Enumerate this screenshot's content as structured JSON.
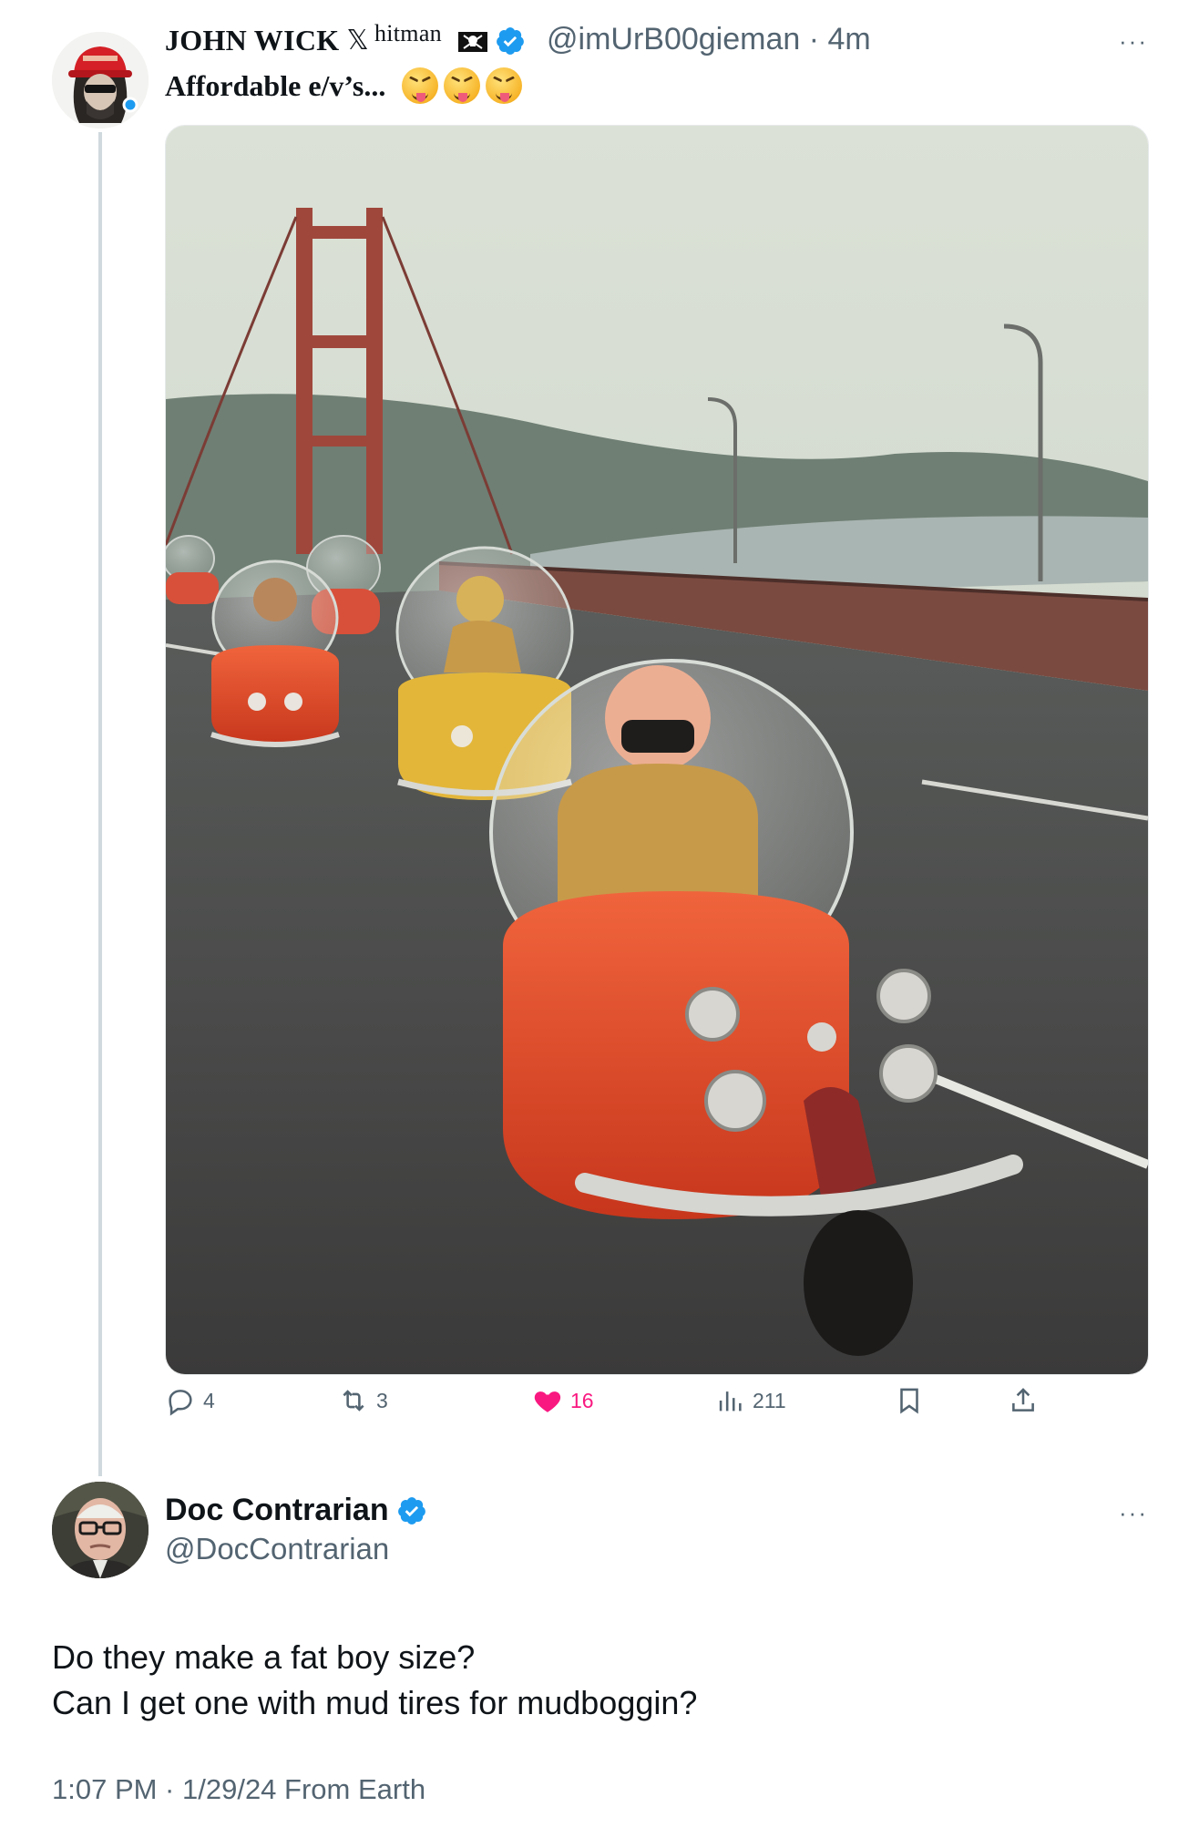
{
  "colors": {
    "verified": "#1d9bf0",
    "like": "#f91880",
    "secondary_text": "#536471",
    "primary_text": "#0f1419"
  },
  "tweet": {
    "author": {
      "display_name": "JOHN WICK",
      "x_glyph": "𝕏",
      "name_suffix": "hitman",
      "flag_icon": "pirate-flag-icon",
      "verified_icon": "verified-badge-icon",
      "handle": "@imUrB00gieman",
      "time": "· 4m"
    },
    "more_label": "···",
    "text": "Affordable e/v’s...",
    "emojis": [
      "squinting-face-with-tongue",
      "squinting-face-with-tongue",
      "squinting-face-with-tongue"
    ],
    "stats": {
      "replies": "4",
      "reposts": "3",
      "likes": "16",
      "views": "211"
    }
  },
  "reply": {
    "author": {
      "display_name": "Doc Contrarian",
      "handle": "@DocContrarian",
      "verified_icon": "verified-badge-icon"
    },
    "more_label": "···",
    "text_line1": "Do they make a fat boy size?",
    "text_line2": "Can I get one with mud tires for mudboggin?",
    "meta": "1:07 PM · 1/29/24 From Earth"
  }
}
